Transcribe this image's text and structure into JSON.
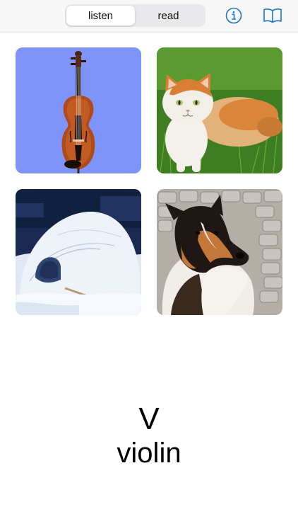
{
  "toolbar": {
    "modes": [
      {
        "label": "listen",
        "selected": true
      },
      {
        "label": "read",
        "selected": false
      }
    ],
    "info_icon": "info-circle-icon",
    "book_icon": "open-book-icon",
    "accent_color": "#1a73c8"
  },
  "tiles": [
    {
      "subject": "violin",
      "background": "#7f94fb"
    },
    {
      "subject": "cat"
    },
    {
      "subject": "igloo"
    },
    {
      "subject": "dog"
    }
  ],
  "card": {
    "letter": "V",
    "word": "violin"
  }
}
